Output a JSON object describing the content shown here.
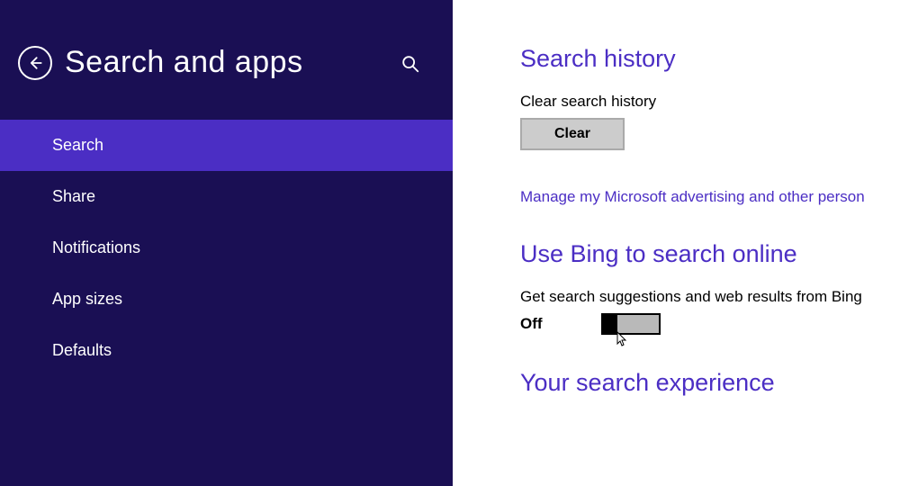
{
  "sidebar": {
    "title": "Search and apps",
    "items": [
      {
        "label": "Search",
        "active": true
      },
      {
        "label": "Share",
        "active": false
      },
      {
        "label": "Notifications",
        "active": false
      },
      {
        "label": "App sizes",
        "active": false
      },
      {
        "label": "Defaults",
        "active": false
      }
    ]
  },
  "main": {
    "search_history": {
      "heading": "Search history",
      "clear_label": "Clear search history",
      "clear_button": "Clear",
      "manage_link": "Manage my Microsoft advertising and other person"
    },
    "bing": {
      "heading": "Use Bing to search online",
      "description": "Get search suggestions and web results from Bing",
      "toggle_state": "Off"
    },
    "experience": {
      "heading": "Your search experience"
    }
  }
}
